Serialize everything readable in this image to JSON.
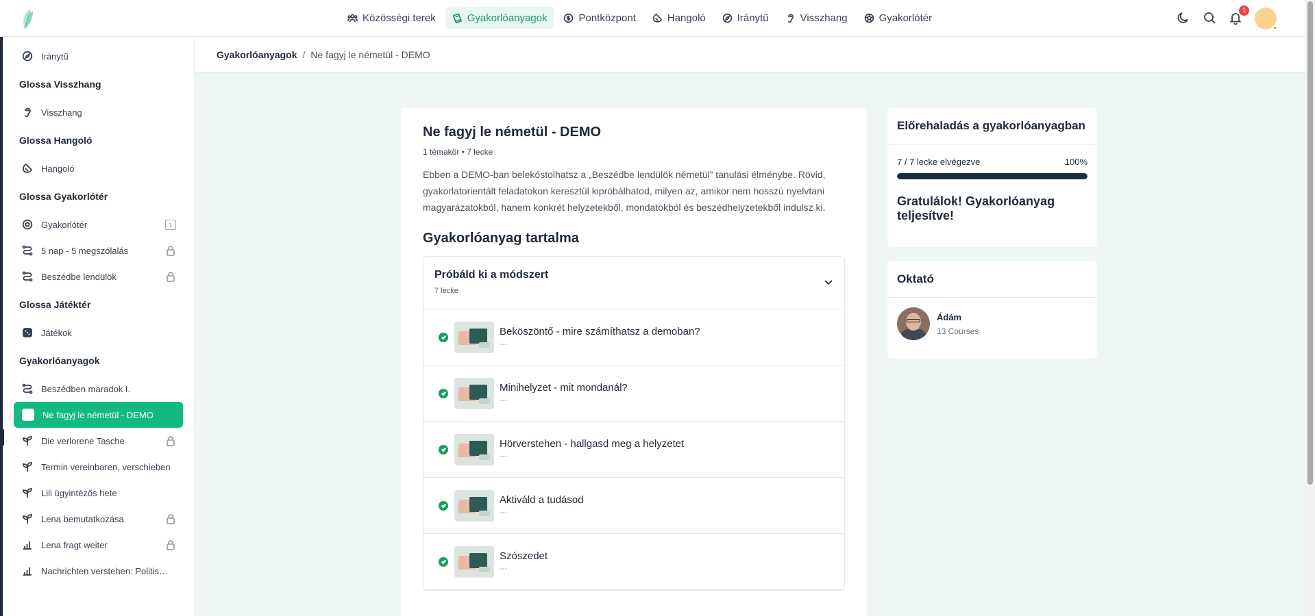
{
  "nav": {
    "items": [
      {
        "label": "Közösségi terek",
        "icon": "community-icon"
      },
      {
        "label": "Gyakorlóanyagok",
        "icon": "practice-icon",
        "active": true
      },
      {
        "label": "Pontközpont",
        "icon": "points-icon"
      },
      {
        "label": "Hangoló",
        "icon": "tuner-icon"
      },
      {
        "label": "Iránytű",
        "icon": "compass-icon"
      },
      {
        "label": "Visszhang",
        "icon": "ear-icon"
      },
      {
        "label": "Gyakorlótér",
        "icon": "ball-icon"
      }
    ],
    "notification_count": "1"
  },
  "sidebar": {
    "top_item": "Iránytű",
    "sections": [
      {
        "title": "Glossa Visszhang",
        "items": [
          {
            "label": "Visszhang"
          }
        ]
      },
      {
        "title": "Glossa Hangoló",
        "items": [
          {
            "label": "Hangoló"
          }
        ]
      },
      {
        "title": "Glossa Gyakorlótér",
        "items": [
          {
            "label": "Gyakorlótér",
            "count": "1"
          },
          {
            "label": "5 nap - 5 megszólalás",
            "locked": true
          },
          {
            "label": "Beszédbe lendülök",
            "locked": true
          }
        ]
      },
      {
        "title": "Glossa Játéktér",
        "items": [
          {
            "label": "Játékok"
          }
        ]
      },
      {
        "title": "Gyakorlóanyagok",
        "items": [
          {
            "label": "Beszédben maradok I."
          },
          {
            "label": "Ne fagyj le németül - DEMO",
            "active": true
          },
          {
            "label": "Die verlorene Tasche",
            "locked": true
          },
          {
            "label": "Termin vereinbaren, verschieben"
          },
          {
            "label": "Lili ügyintézős hete"
          },
          {
            "label": "Lena bemutatkozása",
            "locked": true
          },
          {
            "label": "Lena fragt weiter",
            "locked": true
          },
          {
            "label": "Nachrichten verstehen: Politisches"
          }
        ]
      }
    ]
  },
  "breadcrumb": {
    "root": "Gyakorlóanyagok",
    "separator": "/",
    "current": "Ne fagyj le németül - DEMO"
  },
  "course": {
    "title": "Ne fagyj le németül - DEMO",
    "meta": "1 témakör • 7 lecke",
    "description": "Ebben a DEMO-ban belekóstolhatsz a „Beszédbe lendülök németül” tanulási élménybe. Rövid, gyakorlatorientált feladatokon keresztül kipróbálhatod, milyen az, amikor nem hosszú nyelvtani magyarázatokból, hanem konkrét helyzetekből, mondatokból és beszédhelyzetekből indulsz ki.",
    "contents_title": "Gyakorlóanyag tartalma",
    "topic": {
      "name": "Próbáld ki a módszert",
      "count": "7 lecke",
      "lessons": [
        {
          "title": "Beköszöntő - mire számíthatsz a demoban?",
          "sub": "---"
        },
        {
          "title": "Minihelyzet - mit mondanál?",
          "sub": "---"
        },
        {
          "title": "Hörverstehen - hallgasd meg a helyzetet",
          "sub": "---"
        },
        {
          "title": "Aktiváld a tudásod",
          "sub": "---"
        },
        {
          "title": "Szószedet",
          "sub": "---"
        }
      ]
    }
  },
  "progress": {
    "title": "Előrehaladás a gyakorlóanyagban",
    "done_label": "7 / 7 lecke elvégezve",
    "percent_label": "100%",
    "fraction": 1.0,
    "congrats": "Gratulálok! Gyakorlóanyag teljesítve!"
  },
  "instructor": {
    "title": "Oktató",
    "name": "Ádám",
    "courses": "13 Courses"
  },
  "colors": {
    "accent": "#12b981",
    "accent_text": "#0f9b6b",
    "main_bg": "#eef7f3",
    "progress_fill": "#1f2d3a",
    "check": "#12a05c"
  }
}
